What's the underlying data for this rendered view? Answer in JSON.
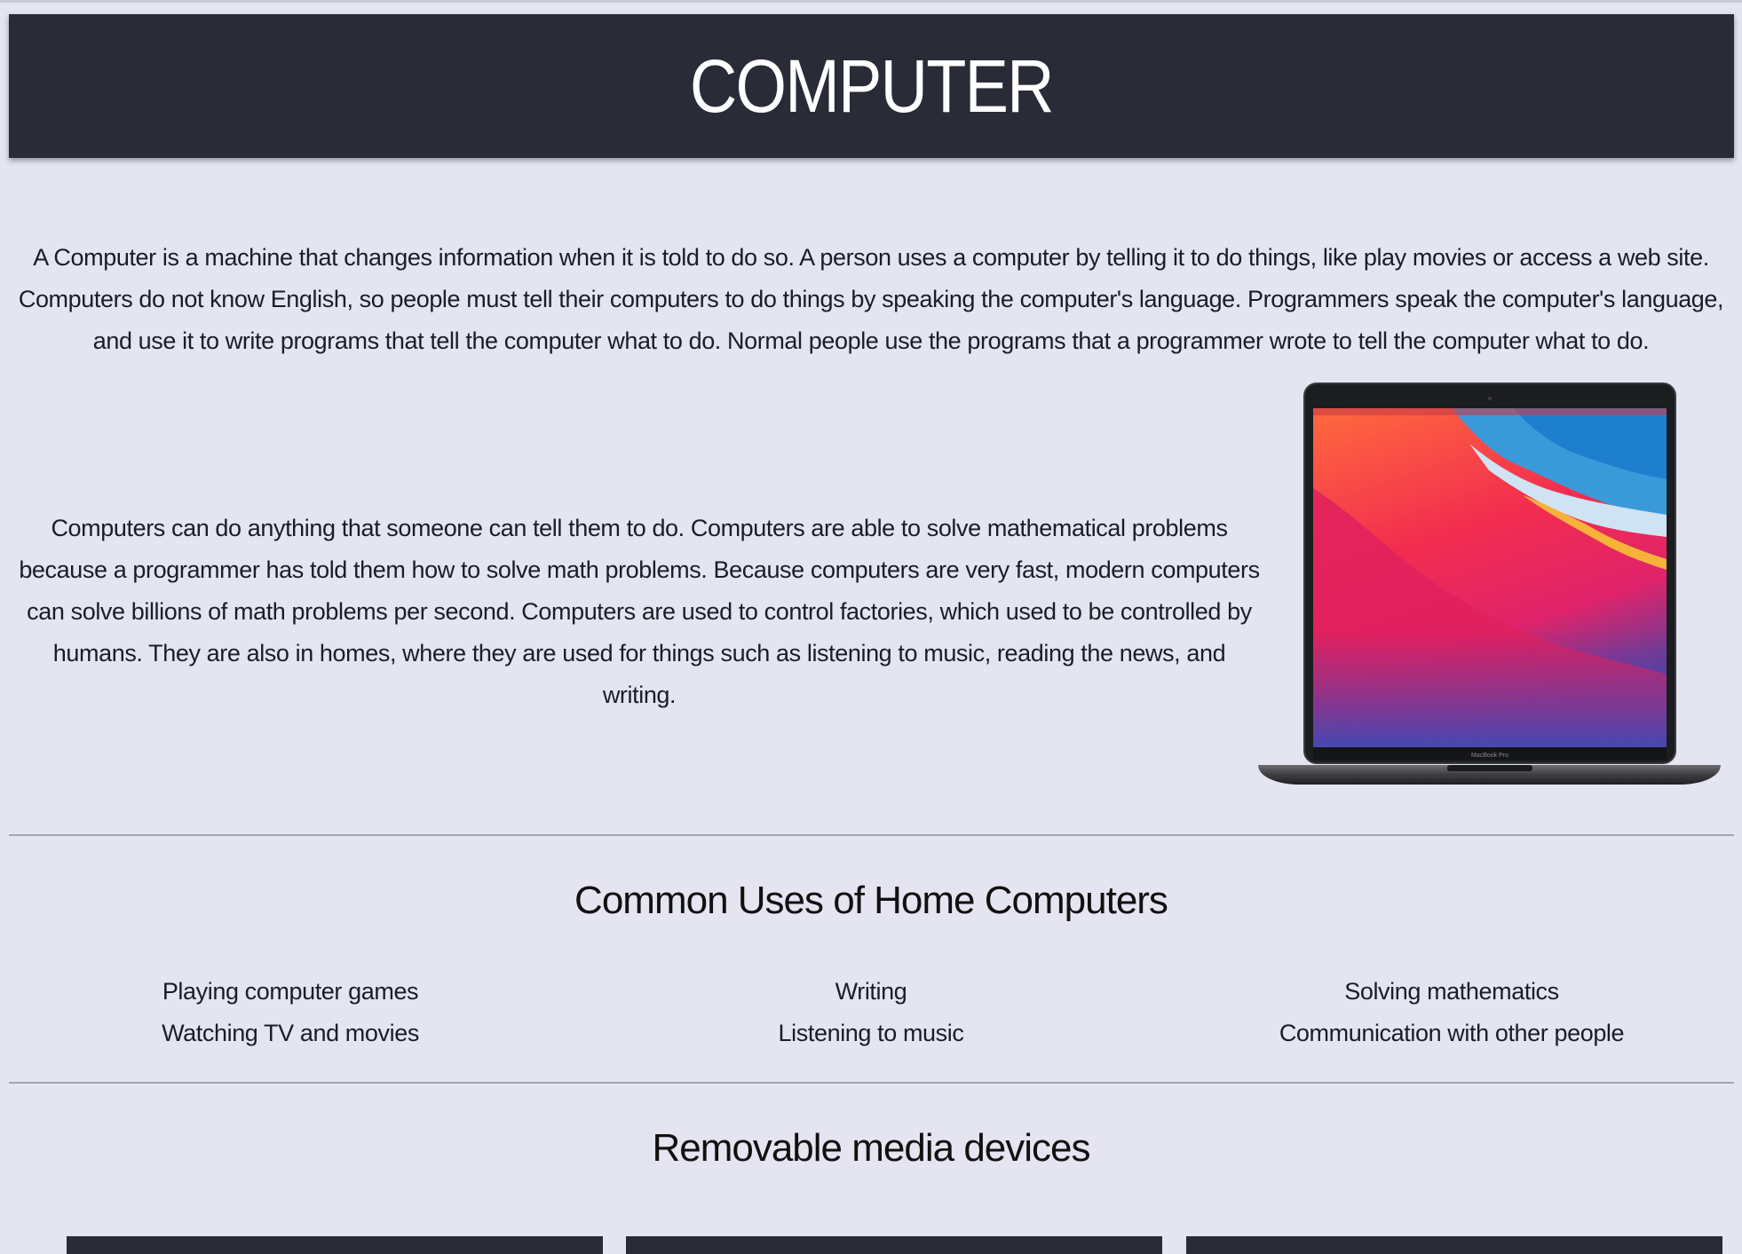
{
  "header": {
    "title": "COMPUTER"
  },
  "intro": {
    "text": "A Computer is a machine that changes information when it is told to do so. A person uses a computer by telling it to do things, like play movies or access a web site. Computers do not know English, so people must tell their computers to do things by speaking the computer's language. Programmers speak the computer's language, and use it to write programs that tell the computer what to do. Normal people use the programs that a programmer wrote to tell the computer what to do."
  },
  "detail": {
    "text": "Computers can do anything that someone can tell them to do. Computers are able to solve mathematical problems because a programmer has told them how to solve math problems. Because computers are very fast, modern computers can solve billions of math problems per second. Computers are used to control factories, which used to be controlled by humans. They are also in homes, where they are used for things such as listening to music, reading the news, and writing.",
    "image_icon": "laptop-image",
    "image_label": "MacBook Pro"
  },
  "uses": {
    "title": "Common Uses of Home Computers",
    "columns": [
      [
        "Playing computer games",
        "Watching TV and movies"
      ],
      [
        "Writing",
        "Listening to music"
      ],
      [
        "Solving mathematics",
        "Communication with other people"
      ]
    ]
  },
  "media": {
    "title": "Removable media devices"
  },
  "colors": {
    "background": "#e4e5f0",
    "header_bg": "#292b37",
    "header_text": "#ffffff"
  }
}
